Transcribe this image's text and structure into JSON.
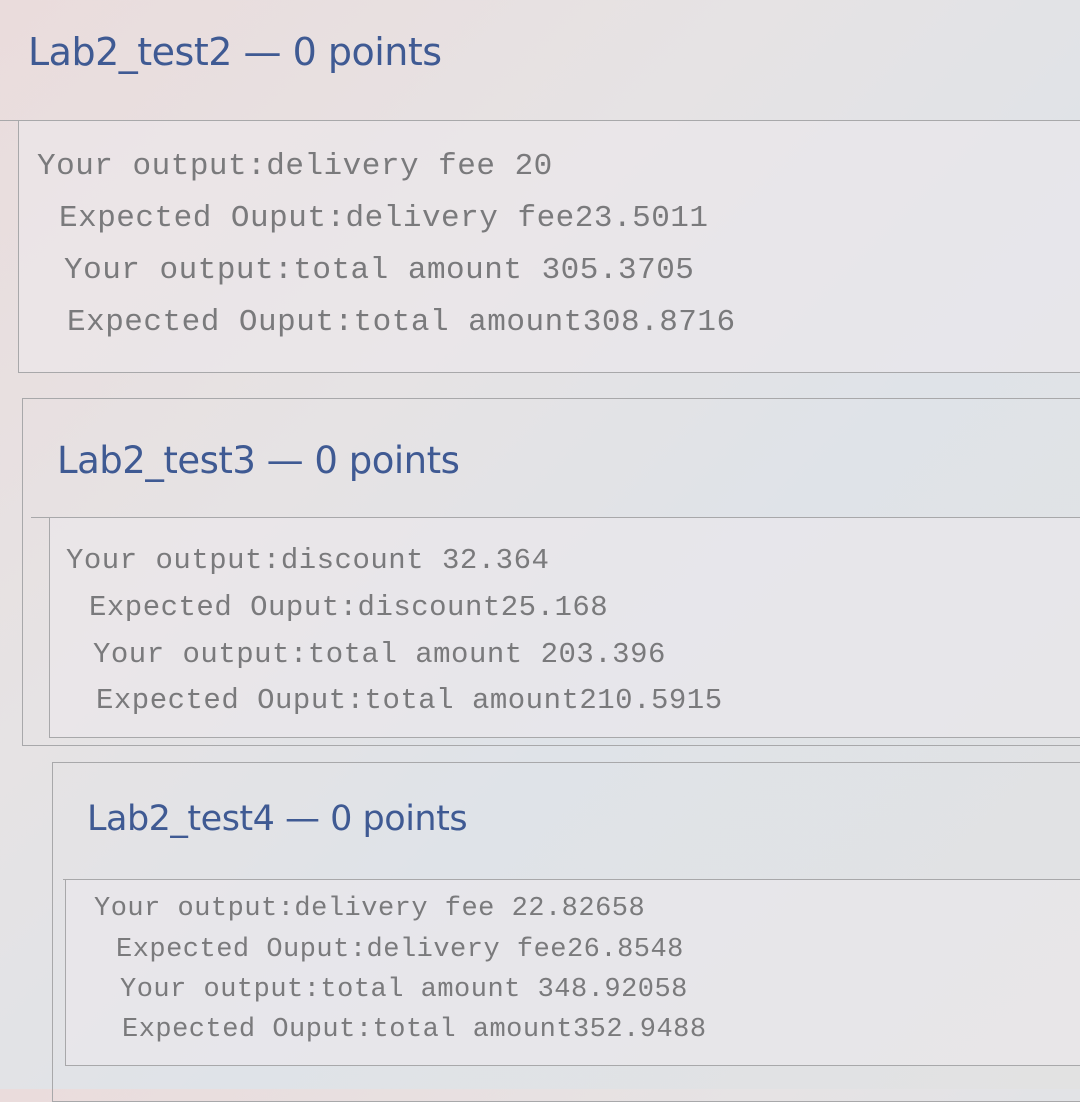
{
  "results": [
    {
      "title": "Lab2_test2 — 0 points",
      "lines": [
        "Your output:delivery fee 20",
        "Expected Ouput:delivery fee23.5011",
        "Your output:total amount 305.3705",
        "Expected Ouput:total amount308.8716"
      ]
    },
    {
      "title": "Lab2_test3 — 0 points",
      "lines": [
        "Your output:discount 32.364",
        "Expected Ouput:discount25.168",
        "Your output:total amount 203.396",
        "Expected Ouput:total amount210.5915"
      ]
    },
    {
      "title": "Lab2_test4 — 0 points",
      "lines": [
        "Your output:delivery fee 22.82658",
        "Expected Ouput:delivery fee26.8548",
        "Your output:total amount 348.92058",
        "Expected Ouput:total amount352.9488"
      ]
    }
  ],
  "colors": {
    "heading": "#3f5a93",
    "output_text": "#7a7a7c",
    "border": "#a8a8aa"
  }
}
